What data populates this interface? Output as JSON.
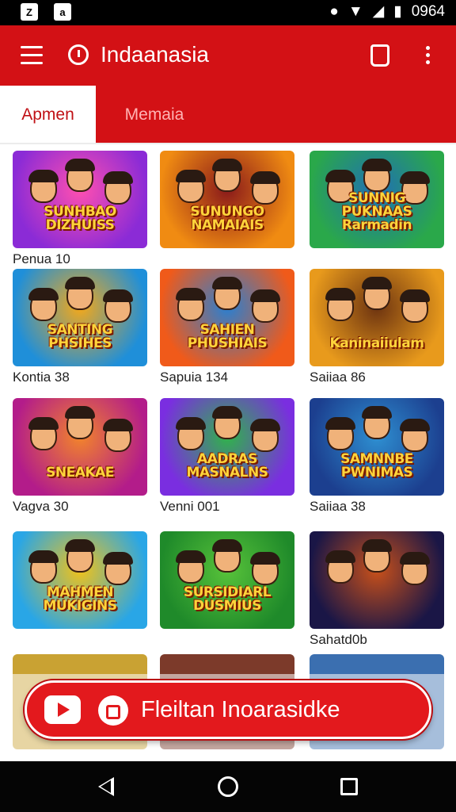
{
  "status_bar": {
    "left_icons": [
      "notification-icon-1",
      "notification-icon-2"
    ],
    "time": "0964"
  },
  "app_bar": {
    "title": "Indaanasia",
    "accent_color": "#d31115"
  },
  "tabs": [
    {
      "label": "Apmen",
      "active": true
    },
    {
      "label": "Memaia",
      "active": false
    }
  ],
  "grid": [
    {
      "title_text": "SUNHBAO DIZHUISS",
      "caption": "Penua 10",
      "badge": "",
      "count": "",
      "colors": [
        "#8b2bd6",
        "#ff4fb0"
      ]
    },
    {
      "title_text": "SUNUNGO NAMAIAIS",
      "caption": "",
      "badge": "",
      "count": "",
      "colors": [
        "#f08b12",
        "#8a1a1a"
      ]
    },
    {
      "title_text": "SUNNIG PUKNAAS Rarmadin",
      "caption": "",
      "badge": "",
      "count": "",
      "colors": [
        "#2aa84a",
        "#1f6fb5"
      ]
    },
    {
      "title_text": "SANTING PHSIHES",
      "caption": "Kontia 38",
      "badge": "",
      "count": "",
      "colors": [
        "#1f8fd9",
        "#f3a81a"
      ]
    },
    {
      "title_text": "SAHIEN PHUSHIAIS",
      "caption": "Sapuia 134",
      "badge": "",
      "count": "",
      "colors": [
        "#f05a1a",
        "#2b7fd0"
      ]
    },
    {
      "title_text": "Kaninaiiulam",
      "caption": "Saiiaa 86",
      "badge": "",
      "count": "",
      "colors": [
        "#e89a1c",
        "#6e3410"
      ]
    },
    {
      "title_text": "SNEAKAE",
      "caption": "Vagva 30",
      "badge": "",
      "count": "",
      "colors": [
        "#b31c8a",
        "#f2842b"
      ]
    },
    {
      "title_text": "AADRAS MASNALNS",
      "caption": "Venni 001",
      "badge": "",
      "count": "",
      "colors": [
        "#7a2ee0",
        "#2fb34a"
      ]
    },
    {
      "title_text": "SAMNNBE PWNIMAS",
      "caption": "Saiiaa 38",
      "badge": "",
      "count": "",
      "colors": [
        "#1c3f8f",
        "#2e8fd1"
      ]
    },
    {
      "title_text": "MAHMEN MUKIGINS",
      "caption": "",
      "badge": "",
      "count": "",
      "colors": [
        "#29a6e6",
        "#f0c21a"
      ]
    },
    {
      "title_text": "SURSIDIARL DUSMIUS",
      "caption": "",
      "badge": "",
      "count": "",
      "colors": [
        "#1f8a2a",
        "#57c23a"
      ]
    },
    {
      "title_text": "",
      "caption": "Sahatd0b",
      "badge": "",
      "count": "",
      "colors": [
        "#1a1646",
        "#c8501a"
      ]
    }
  ],
  "cta": {
    "label": "Fleiltan Inoarasidke"
  }
}
